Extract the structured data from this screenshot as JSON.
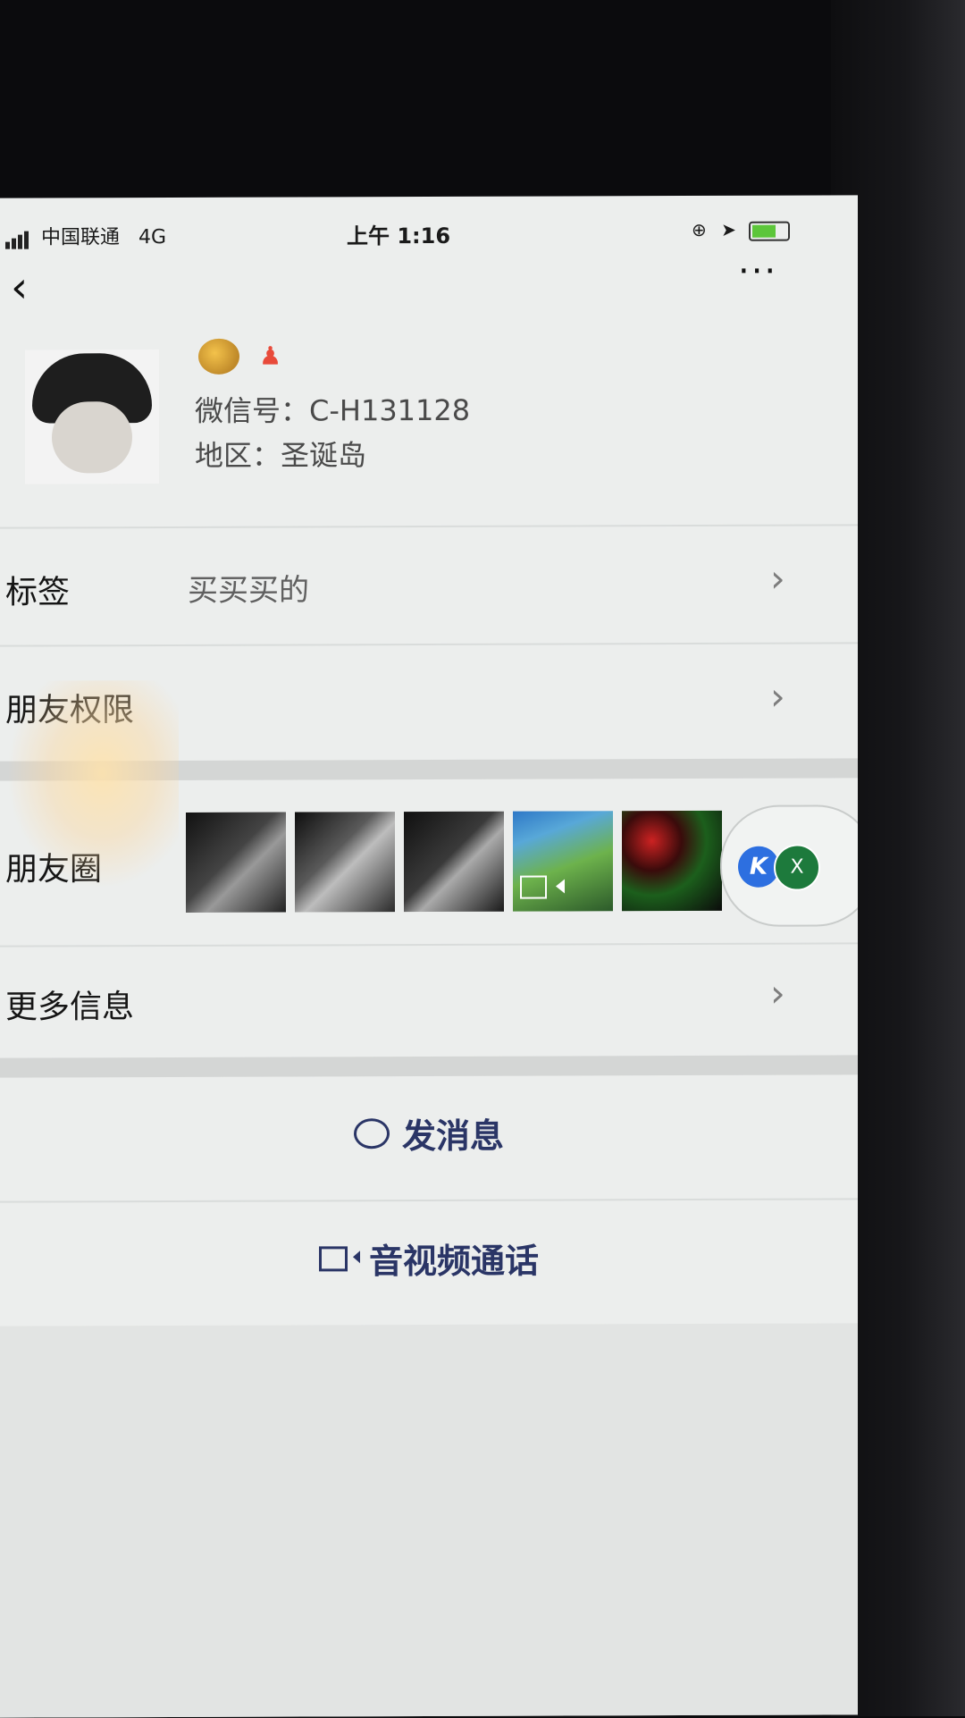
{
  "status_bar": {
    "carrier": "中国联通",
    "network": "4G",
    "time": "上午 1:16",
    "lock_icon": "orientation-lock-icon",
    "location_icon": "location-arrow-icon",
    "battery_icon": "battery-charging-icon",
    "battery_color": "#5cc63a"
  },
  "nav": {
    "back_glyph": "‹",
    "more_glyph": "···"
  },
  "profile": {
    "wechat_id": "微信号：C-H131128",
    "region": "地区：圣诞岛"
  },
  "rows": {
    "tags_label": "标签",
    "tags_value": "买买买的",
    "permissions_label": "朋友权限",
    "moments_label": "朋友圈",
    "more_info_label": "更多信息"
  },
  "floating": {
    "k_label": "K",
    "x_label": "X"
  },
  "actions": {
    "message_label": "发消息",
    "call_label": "音视频通话",
    "accent_color": "#2a3566"
  }
}
